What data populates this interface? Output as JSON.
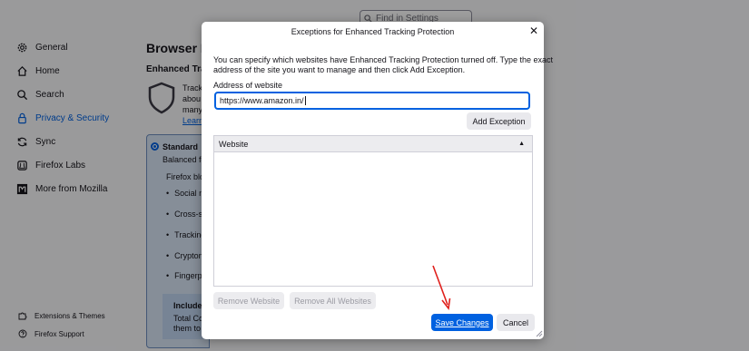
{
  "search": {
    "placeholder": "Find in Settings"
  },
  "sidebar": {
    "items": [
      {
        "label": "General",
        "icon": "gear-icon"
      },
      {
        "label": "Home",
        "icon": "home-icon"
      },
      {
        "label": "Search",
        "icon": "search-icon"
      },
      {
        "label": "Privacy & Security",
        "icon": "lock-icon",
        "active": true
      },
      {
        "label": "Sync",
        "icon": "sync-icon"
      },
      {
        "label": "Firefox Labs",
        "icon": "labs-icon"
      },
      {
        "label": "More from Mozilla",
        "icon": "mozilla-icon"
      }
    ],
    "footer": [
      {
        "label": "Extensions & Themes",
        "icon": "puzzle-icon"
      },
      {
        "label": "Firefox Support",
        "icon": "help-icon"
      }
    ]
  },
  "page": {
    "title": "Browser Pri",
    "etp_title": "Enhanced Track",
    "etp_desc": "Track\nabou\nmany",
    "learn_more": "Learn",
    "standard": {
      "label": "Standard",
      "sub": "Balanced fo",
      "blocks": "Firefox blo",
      "items": [
        "Social m",
        "Cross-sit",
        "Tracking",
        "Cryptom",
        "Fingerpr"
      ]
    },
    "includes": {
      "title": "Includes",
      "desc": "Total Co\nthem to"
    }
  },
  "dialog": {
    "title": "Exceptions for Enhanced Tracking Protection",
    "close": "✕",
    "description": "You can specify which websites have Enhanced Tracking Protection turned off. Type the exact\naddress of the site you want to manage and then click Add Exception.",
    "address_label": "Address of website",
    "address_value": "https://www.amazon.in/",
    "add_exception": "Add Exception",
    "table_header": "Website",
    "sort_indicator": "▲",
    "remove_website": "Remove Website",
    "remove_all": "Remove All Websites",
    "save": "Save Changes",
    "cancel": "Cancel"
  },
  "colors": {
    "accent": "#0061e0",
    "annotation_arrow": "#e0201c"
  }
}
